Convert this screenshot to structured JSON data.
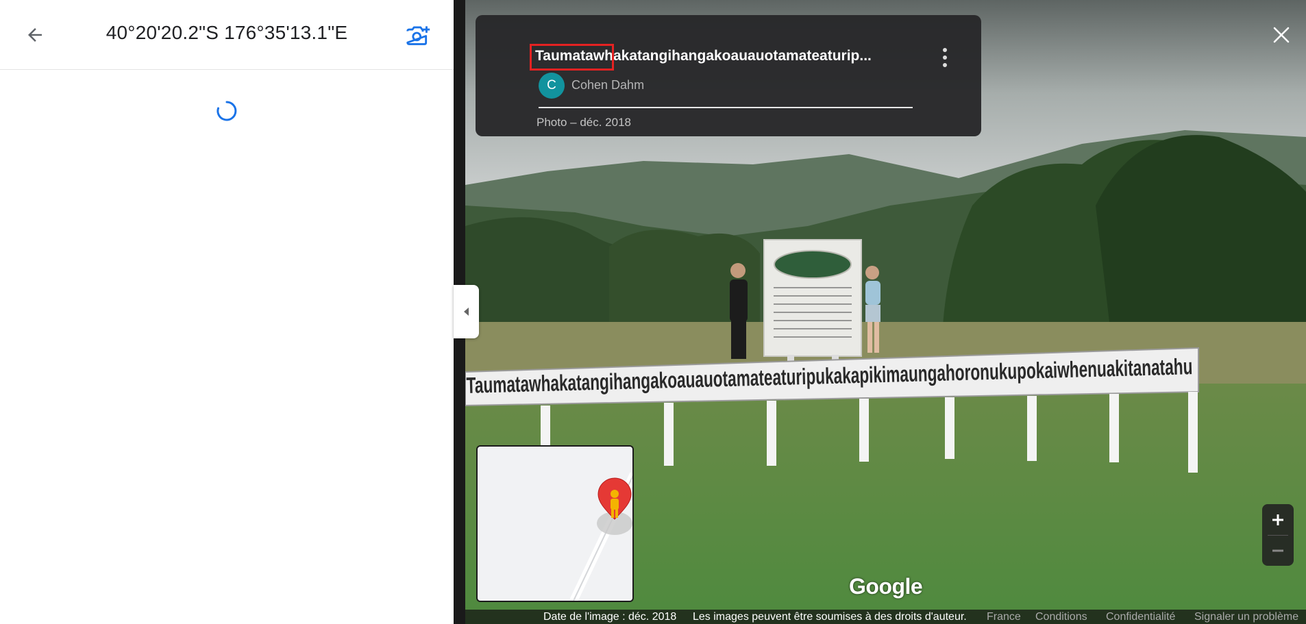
{
  "left_panel": {
    "title": "40°20'20.2\"S 176°35'13.1\"E",
    "back_icon": "arrow-back-icon",
    "add_photo_icon": "add-photo-camera-icon",
    "loading_icon": "spinner-icon"
  },
  "info_card": {
    "title": "Taumatawhakatangihangakoauauotamateaturip...",
    "author_initial": "C",
    "author_name": "Cohen Dahm",
    "photo_date": "Photo – déc. 2018",
    "menu_icon": "more-vertical-icon"
  },
  "viewer": {
    "close_icon": "close-icon",
    "sign_text": "Taumatawhakatangihangakoauauotamateaturipukakapikimaungahoronukupokaiwhenuakitanatahu",
    "google_logo": "Google",
    "zoom_in_label": "+",
    "zoom_out_label": "−",
    "collapse_icon": "chevron-left-icon",
    "pegman_icon": "pegman-icon"
  },
  "footer": {
    "image_date": "Date de l'image : déc. 2018",
    "copyright": "Les images peuvent être soumises à des droits d'auteur.",
    "links": [
      "France",
      "Conditions",
      "Confidentialité",
      "Signaler un problème"
    ]
  },
  "colors": {
    "accent_blue": "#1a73e8",
    "highlight_red": "#e52222",
    "avatar_teal": "#12939e",
    "card_bg": "#28282a"
  }
}
